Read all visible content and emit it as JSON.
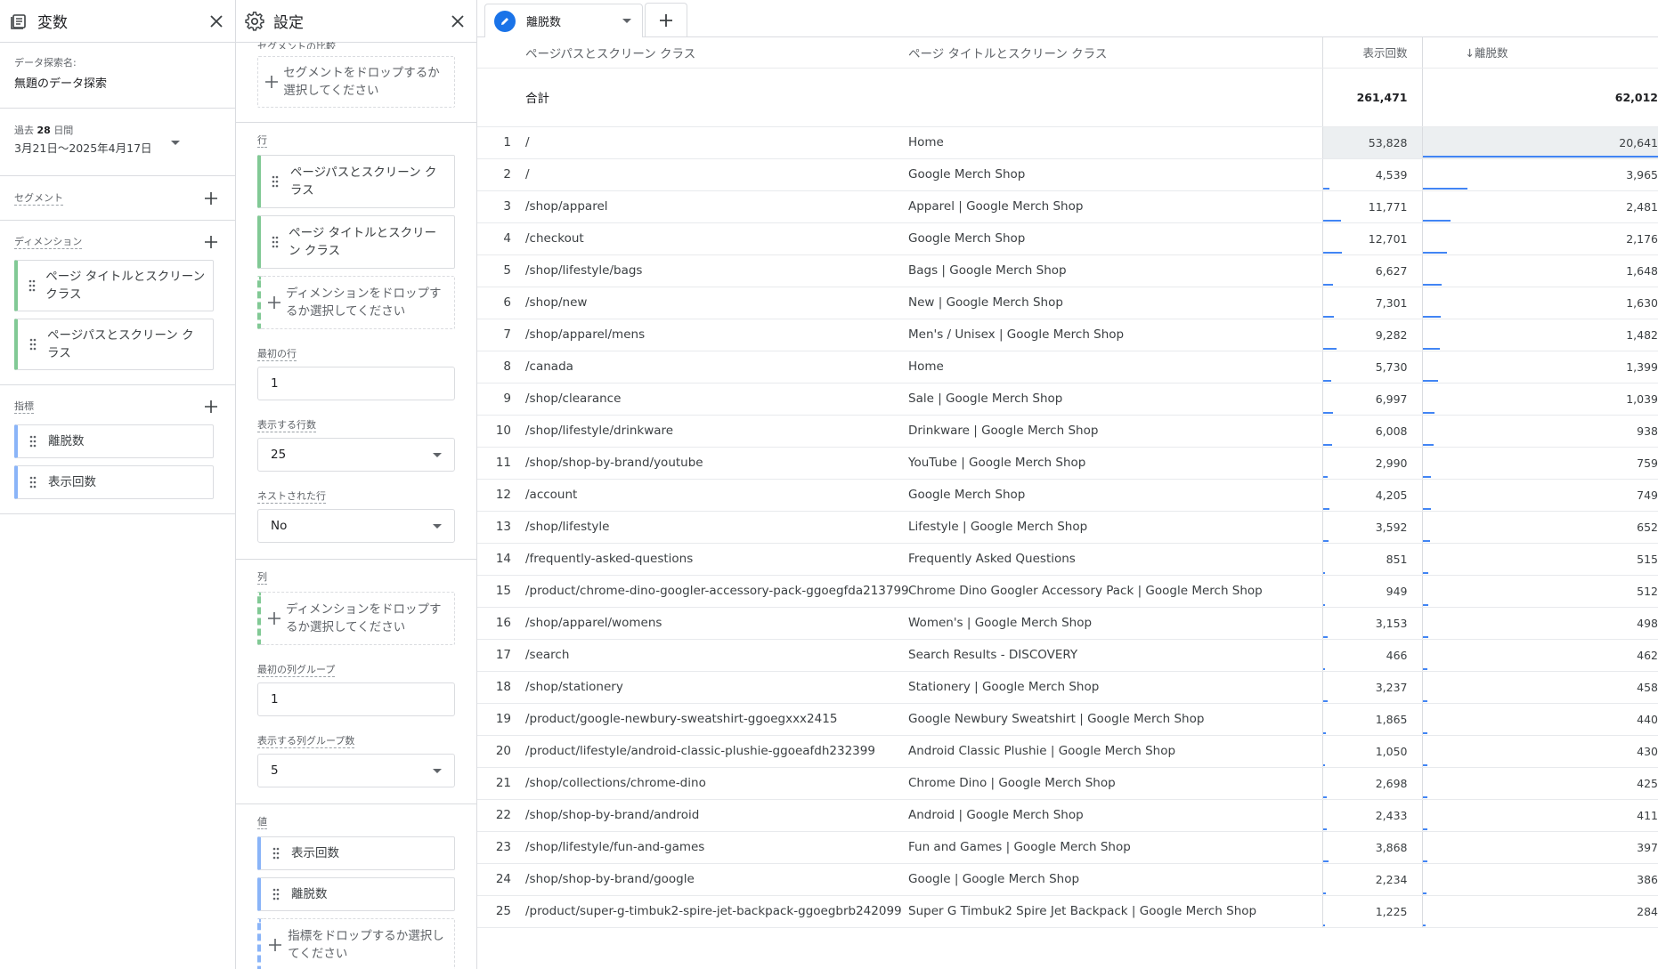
{
  "variables_panel": {
    "title": "変数",
    "exploration_name_label": "データ探索名:",
    "exploration_name": "無題のデータ探索",
    "date_range_label_prefix": "過去",
    "date_range_days": "28",
    "date_range_label_suffix": "日間",
    "date_range": "3月21日～2025年4月17日",
    "segments_label": "セグメント",
    "dimensions_label": "ディメンション",
    "dimensions": [
      "ページ タイトルとスクリーン クラス",
      "ページパスとスクリーン クラス"
    ],
    "metrics_label": "指標",
    "metrics": [
      "離脱数",
      "表示回数"
    ]
  },
  "settings_panel": {
    "title": "設定",
    "segment_compare_label": "セグメントの比較",
    "segment_drop": "セグメントをドロップするか選択してください",
    "rows_label": "行",
    "rows": [
      "ページパスとスクリーン クラス",
      "ページ タイトルとスクリーン クラス"
    ],
    "row_drop": "ディメンションをドロップするか選択してください",
    "first_row_label": "最初の行",
    "first_row": "1",
    "show_rows_label": "表示する行数",
    "show_rows": "25",
    "nested_rows_label": "ネストされた行",
    "nested_rows": "No",
    "columns_label": "列",
    "column_drop": "ディメンションをドロップするか選択してください",
    "first_col_group_label": "最初の列グループ",
    "first_col_group": "1",
    "show_col_groups_label": "表示する列グループ数",
    "show_col_groups": "5",
    "values_label": "値",
    "values": [
      "表示回数",
      "離脱数"
    ],
    "value_drop": "指標をドロップするか選択してください"
  },
  "tab": {
    "label": "離脱数"
  },
  "table": {
    "headers": {
      "path": "ページパスとスクリーン クラス",
      "title": "ページ タイトルとスクリーン クラス",
      "views": "表示回数",
      "exits": "↓離脱数"
    },
    "total_label": "合計",
    "total_views": "261,471",
    "total_exits": "62,012",
    "rows": [
      {
        "idx": "1",
        "path": "/",
        "title": "Home",
        "views": "53,828",
        "exits": "20,641"
      },
      {
        "idx": "2",
        "path": "/",
        "title": "Google Merch Shop",
        "views": "4,539",
        "exits": "3,965"
      },
      {
        "idx": "3",
        "path": "/shop/apparel",
        "title": "Apparel | Google Merch Shop",
        "views": "11,771",
        "exits": "2,481"
      },
      {
        "idx": "4",
        "path": "/checkout",
        "title": "Google Merch Shop",
        "views": "12,701",
        "exits": "2,176"
      },
      {
        "idx": "5",
        "path": "/shop/lifestyle/bags",
        "title": "Bags | Google Merch Shop",
        "views": "6,627",
        "exits": "1,648"
      },
      {
        "idx": "6",
        "path": "/shop/new",
        "title": "New | Google Merch Shop",
        "views": "7,301",
        "exits": "1,630"
      },
      {
        "idx": "7",
        "path": "/shop/apparel/mens",
        "title": "Men's / Unisex | Google Merch Shop",
        "views": "9,282",
        "exits": "1,482"
      },
      {
        "idx": "8",
        "path": "/canada",
        "title": "Home",
        "views": "5,730",
        "exits": "1,399"
      },
      {
        "idx": "9",
        "path": "/shop/clearance",
        "title": "Sale | Google Merch Shop",
        "views": "6,997",
        "exits": "1,039"
      },
      {
        "idx": "10",
        "path": "/shop/lifestyle/drinkware",
        "title": "Drinkware | Google Merch Shop",
        "views": "6,008",
        "exits": "938"
      },
      {
        "idx": "11",
        "path": "/shop/shop-by-brand/youtube",
        "title": "YouTube | Google Merch Shop",
        "views": "2,990",
        "exits": "759"
      },
      {
        "idx": "12",
        "path": "/account",
        "title": "Google Merch Shop",
        "views": "4,205",
        "exits": "749"
      },
      {
        "idx": "13",
        "path": "/shop/lifestyle",
        "title": "Lifestyle | Google Merch Shop",
        "views": "3,592",
        "exits": "652"
      },
      {
        "idx": "14",
        "path": "/frequently-asked-questions",
        "title": "Frequently Asked Questions",
        "views": "851",
        "exits": "515"
      },
      {
        "idx": "15",
        "path": "/product/chrome-dino-googler-accessory-pack-ggoegfda213799",
        "title": "Chrome Dino Googler Accessory Pack | Google Merch Shop",
        "views": "949",
        "exits": "512"
      },
      {
        "idx": "16",
        "path": "/shop/apparel/womens",
        "title": "Women's | Google Merch Shop",
        "views": "3,153",
        "exits": "498"
      },
      {
        "idx": "17",
        "path": "/search",
        "title": "Search Results - DISCOVERY",
        "views": "466",
        "exits": "462"
      },
      {
        "idx": "18",
        "path": "/shop/stationery",
        "title": "Stationery | Google Merch Shop",
        "views": "3,237",
        "exits": "458"
      },
      {
        "idx": "19",
        "path": "/product/google-newbury-sweatshirt-ggoegxxx2415",
        "title": "Google Newbury Sweatshirt | Google Merch Shop",
        "views": "1,865",
        "exits": "440"
      },
      {
        "idx": "20",
        "path": "/product/lifestyle/android-classic-plushie-ggoeafdh232399",
        "title": "Android Classic Plushie | Google Merch Shop",
        "views": "1,050",
        "exits": "430"
      },
      {
        "idx": "21",
        "path": "/shop/collections/chrome-dino",
        "title": "Chrome Dino | Google Merch Shop",
        "views": "2,698",
        "exits": "425"
      },
      {
        "idx": "22",
        "path": "/shop/shop-by-brand/android",
        "title": "Android | Google Merch Shop",
        "views": "2,433",
        "exits": "411"
      },
      {
        "idx": "23",
        "path": "/shop/lifestyle/fun-and-games",
        "title": "Fun and Games | Google Merch Shop",
        "views": "3,868",
        "exits": "397"
      },
      {
        "idx": "24",
        "path": "/shop/shop-by-brand/google",
        "title": "Google | Google Merch Shop",
        "views": "2,234",
        "exits": "386"
      },
      {
        "idx": "25",
        "path": "/product/super-g-timbuk2-spire-jet-backpack-ggoegbrb242099",
        "title": "Super G Timbuk2 Spire Jet Backpack | Google Merch Shop",
        "views": "1,225",
        "exits": "284"
      }
    ]
  },
  "colors": {
    "accent": "#1a73e8",
    "bar": "#4285f4",
    "dimension": "#81c995",
    "metric": "#8ab4f8"
  }
}
